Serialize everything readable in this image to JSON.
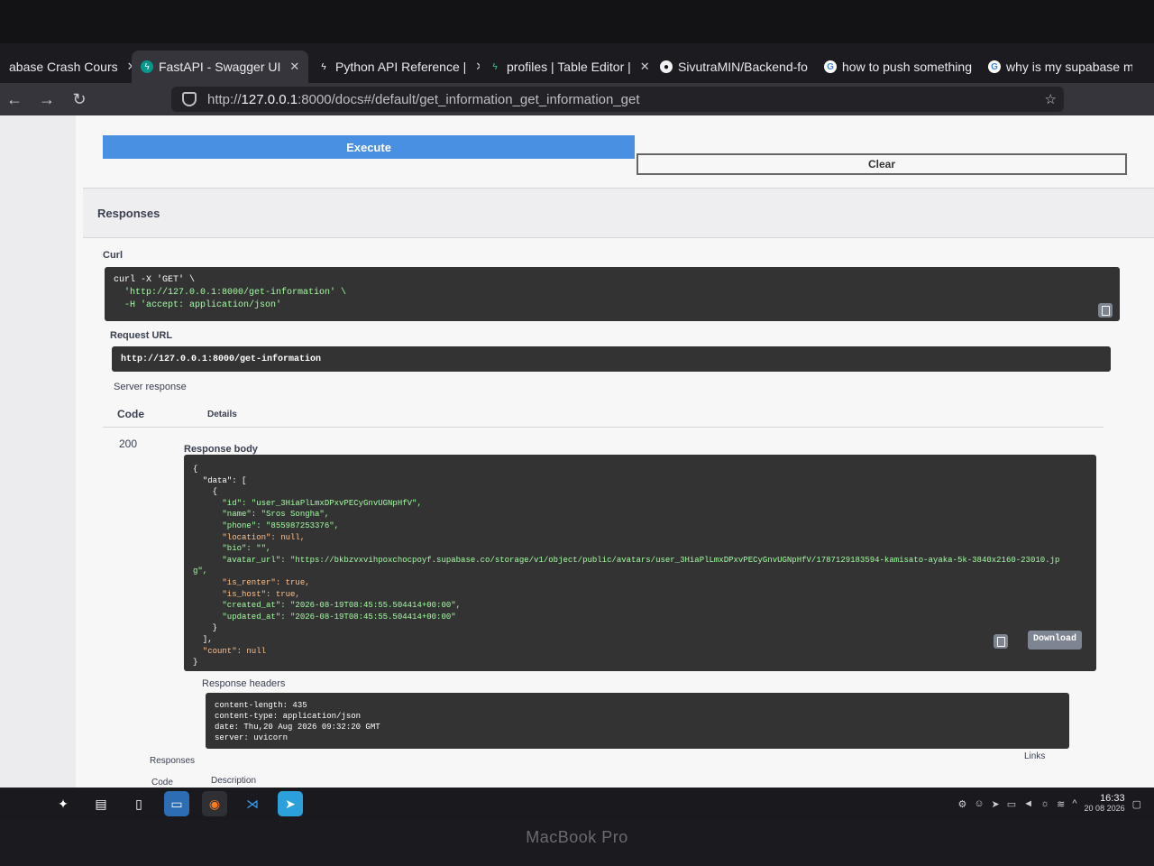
{
  "browser": {
    "tabs": [
      {
        "title": "abase Crash Cours",
        "icon": "supabase-icon",
        "active": false
      },
      {
        "title": "FastAPI - Swagger UI",
        "icon": "fastapi-icon",
        "active": true
      },
      {
        "title": "Python API Reference |",
        "icon": "supabase-icon",
        "active": false
      },
      {
        "title": "profiles | Table Editor |",
        "icon": "supabase-icon",
        "active": false
      },
      {
        "title": "SivutraMIN/Backend-fo",
        "icon": "github-icon",
        "active": false
      },
      {
        "title": "how to push something",
        "icon": "google-icon",
        "active": false
      },
      {
        "title": "why is my supabase m",
        "icon": "google-icon",
        "active": false
      }
    ],
    "url_prefix": "http://",
    "url_host": "127.0.0.1",
    "url_rest": ":8000/docs#/default/get_information_get_information_get"
  },
  "swagger": {
    "execute_label": "Execute",
    "clear_label": "Clear",
    "responses_title": "Responses",
    "curl_label": "Curl",
    "curl_lines": [
      "curl -X 'GET' \\",
      "  'http://127.0.0.1:8000/get-information' \\",
      "  -H 'accept: application/json'"
    ],
    "request_url_label": "Request URL",
    "request_url": "http://127.0.0.1:8000/get-information",
    "server_response_label": "Server response",
    "code_header": "Code",
    "details_header": "Details",
    "status_code": "200",
    "response_body_label": "Response body",
    "response_body_lines": [
      "{",
      "  \"data\": [",
      "    {",
      "      \"id\": \"user_3HiaPlLmxDPxvPECyGnvUGNpHfV\",",
      "      \"name\": \"Sros Songha\",",
      "      \"phone\": \"855987253376\",",
      "      \"location\": null,",
      "      \"bio\": \"\",",
      "      \"avatar_url\": \"https://bkbzvxvihpoxchocpoyf.supabase.co/storage/v1/object/public/avatars/user_3HiaPlLmxDPxvPECyGnvUGNpHfV/1787129183594-kamisato-ayaka-5k-3840x2160-23010.jp",
      "g\",",
      "      \"is_renter\": true,",
      "      \"is_host\": true,",
      "      \"created_at\": \"2026-08-19T08:45:55.504414+00:00\",",
      "      \"updated_at\": \"2026-08-19T08:45:55.504414+00:00\"",
      "    }",
      "  ],",
      "  \"count\": null",
      "}"
    ],
    "download_label": "Download",
    "response_headers_label": "Response headers",
    "response_headers_lines": [
      "content-length: 435",
      "content-type: application/json",
      "date: Thu,20 Aug 2026 09:32:20 GMT",
      "server: uvicorn"
    ],
    "bottom_responses_label": "Responses",
    "bottom_code_label": "Code",
    "bottom_description_label": "Description",
    "bottom_links_label": "Links"
  },
  "taskbar": {
    "time": "16:33",
    "date": "20 08 2026"
  },
  "device": {
    "brand": "MacBook Pro"
  }
}
